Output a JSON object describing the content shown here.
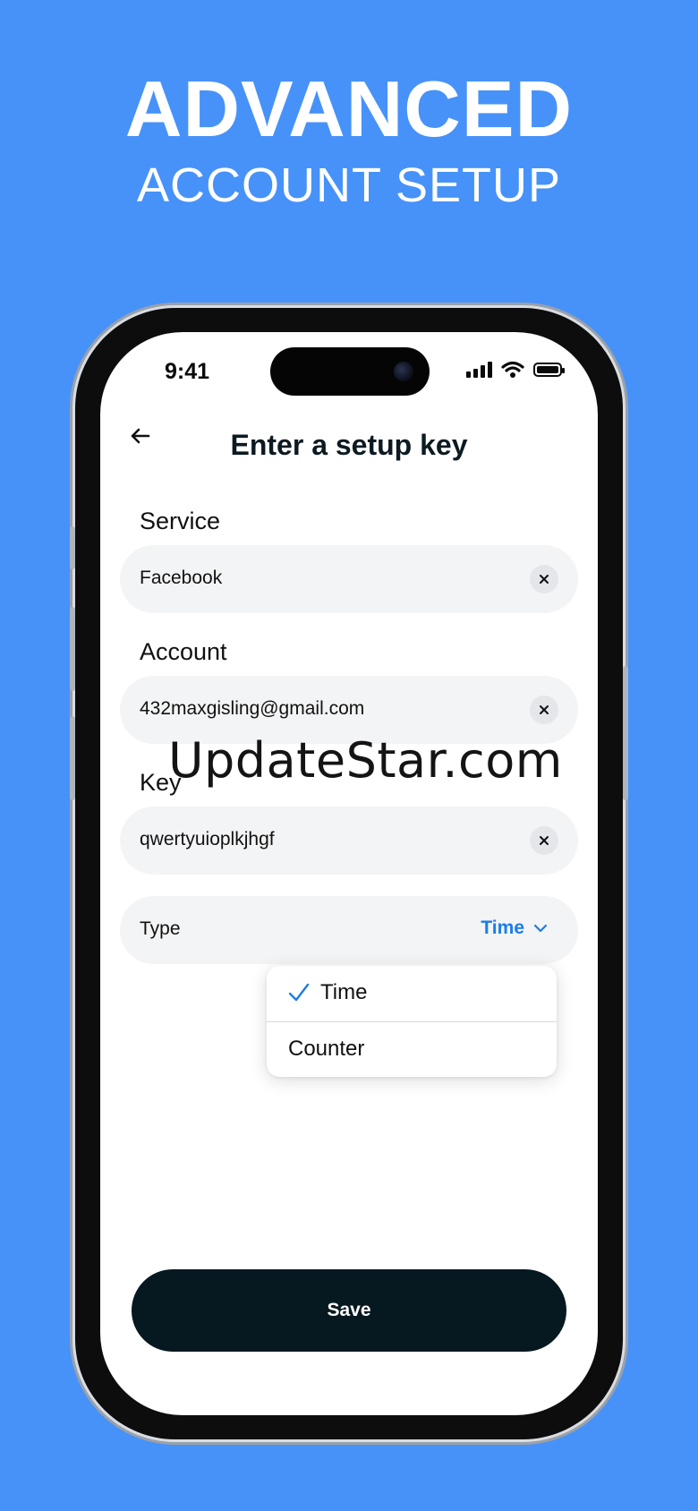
{
  "banner": {
    "headline": "ADVANCED",
    "subhead": "ACCOUNT SETUP"
  },
  "status": {
    "time": "9:41"
  },
  "header": {
    "title": "Enter a setup key",
    "back_icon": "arrow-left-icon"
  },
  "form": {
    "service": {
      "label": "Service",
      "value": "Facebook"
    },
    "account": {
      "label": "Account",
      "value": "432maxgisling@gmail.com"
    },
    "key": {
      "label": "Key",
      "value": "qwertyuioplkjhgf"
    },
    "type": {
      "label": "Type",
      "value": "Time"
    }
  },
  "dropdown": {
    "options": [
      {
        "label": "Time",
        "selected": true
      },
      {
        "label": "Counter",
        "selected": false
      }
    ]
  },
  "watermark": "UpdateStar.com",
  "actions": {
    "save_label": "Save"
  },
  "colors": {
    "background": "#4792f9",
    "accent": "#1b7de8",
    "button": "#061820"
  }
}
